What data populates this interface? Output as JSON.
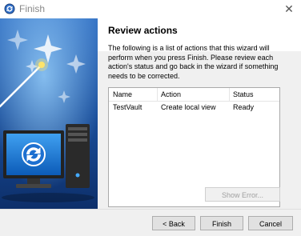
{
  "window": {
    "title": "Finish",
    "close_glyph": "✕"
  },
  "page": {
    "heading": "Review actions",
    "description": "The following is a list of actions that this wizard will perform when you press Finish. Please review each action's status and go back in the wizard if something needs to be corrected."
  },
  "actions_list": {
    "columns": [
      "Name",
      "Action",
      "Status"
    ],
    "rows": [
      {
        "name": "TestVault",
        "action": "Create local view",
        "status": "Ready"
      }
    ]
  },
  "buttons": {
    "show_error": "Show Error...",
    "back": "< Back",
    "finish": "Finish",
    "cancel": "Cancel"
  },
  "colors": {
    "banner_top": "#1a4f9c",
    "banner_bottom": "#0d2f6a",
    "accent": "#0078d7"
  }
}
